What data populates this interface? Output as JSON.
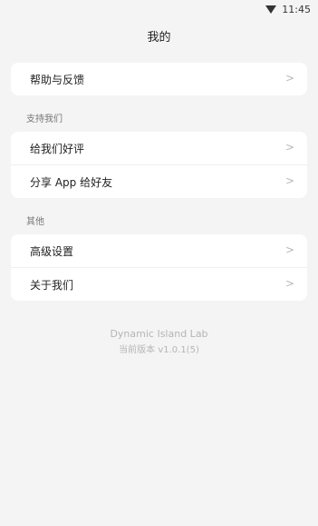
{
  "status_bar": {
    "time": "11:45"
  },
  "header": {
    "title": "我的"
  },
  "group1": {
    "items": [
      {
        "label": "帮助与反馈"
      }
    ]
  },
  "support": {
    "label": "支持我们",
    "items": [
      {
        "label": "给我们好评"
      },
      {
        "label": "分享 App 给好友"
      }
    ]
  },
  "other": {
    "label": "其他",
    "items": [
      {
        "label": "高级设置"
      },
      {
        "label": "关于我们"
      }
    ]
  },
  "footer": {
    "app_name": "Dynamic Island Lab",
    "version": "当前版本 v1.0.1(5)"
  }
}
